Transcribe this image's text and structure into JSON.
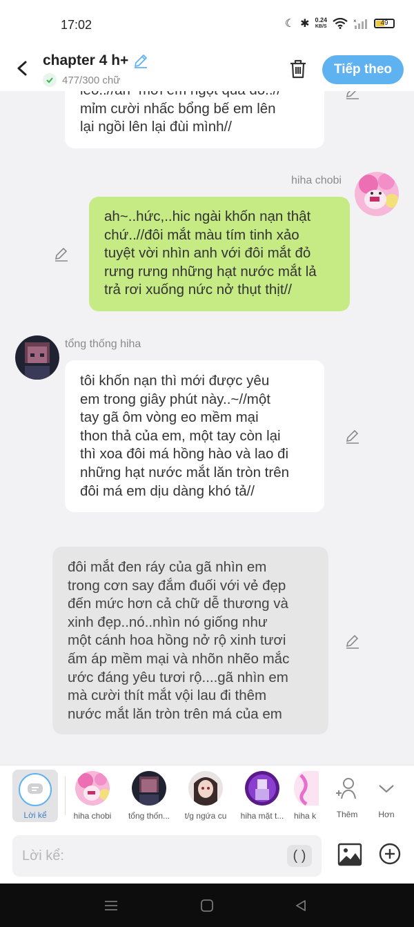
{
  "status_bar": {
    "time": "17:02",
    "net_speed_top": "0.24",
    "net_speed_bottom": "KB/S",
    "battery": "49"
  },
  "header": {
    "title": "chapter 4 h+",
    "word_count": "477/300 chữ",
    "next_button": "Tiếp theo"
  },
  "messages": [
    {
      "type": "narration",
      "lines": [
        "leo..//ah~mới em ngọt quá đó..//",
        "mỉm cười nhấc bổng bế em lên",
        "lại ngồi lên lại đùi mình//"
      ]
    },
    {
      "type": "sent",
      "sender": "hiha chobi",
      "lines": [
        "ah~..hức,..hic ngài khốn nạn thật",
        "chứ..//đôi mắt màu tím tinh xảo",
        "tuyệt vời nhìn anh với đôi mắt đỏ",
        "rưng rưng những hạt nước mắt lả",
        "trả rơi xuống nức nở thụt thịt//"
      ]
    },
    {
      "type": "received",
      "sender": "tổng thống hiha",
      "lines": [
        "tôi khốn nạn thì mới được yêu",
        "em trong giây phút này..~//một",
        "tay gã ôm vòng eo mềm mại",
        "thon thả của em, một tay còn lại",
        "thì xoa đôi má hồng hào và lao đi",
        "những hạt nước mắt lăn tròn trên",
        "đôi má em dịu dàng khó tả//"
      ]
    },
    {
      "type": "narration_gray",
      "lines": [
        "đôi mắt đen ráy của gã nhìn em",
        "trong cơn say đắm đuối với vẻ đẹp",
        "đến mức hơn cả chữ dễ thương và",
        "xinh đẹp..nó..nhìn nó giống như",
        "một cánh hoa hồng nở rộ xinh tươi",
        "ấm áp mềm mại và nhõn nhẽo mắc",
        "ước đáng yêu tươi rộ....gã nhìn em",
        "mà cười thít mắt vội lau đi thêm",
        "nước mắt lăn tròn trên má của em"
      ]
    }
  ],
  "characters": {
    "narrator_label": "Lời kể",
    "list": [
      {
        "name": "hiha chobi"
      },
      {
        "name": "tổng thốn..."
      },
      {
        "name": "t/g ngứa cu"
      },
      {
        "name": "hiha mặt t..."
      },
      {
        "name": "hiha k"
      }
    ],
    "add_label": "Thêm",
    "more_label": "Hơn"
  },
  "input": {
    "placeholder": "Lời kể:",
    "paren_label": "( )"
  },
  "colors": {
    "accent": "#5fb2f0",
    "sent_bubble": "#c6ea84",
    "narration_bubble": "#e6e6e6",
    "background": "#f2f2f4"
  }
}
